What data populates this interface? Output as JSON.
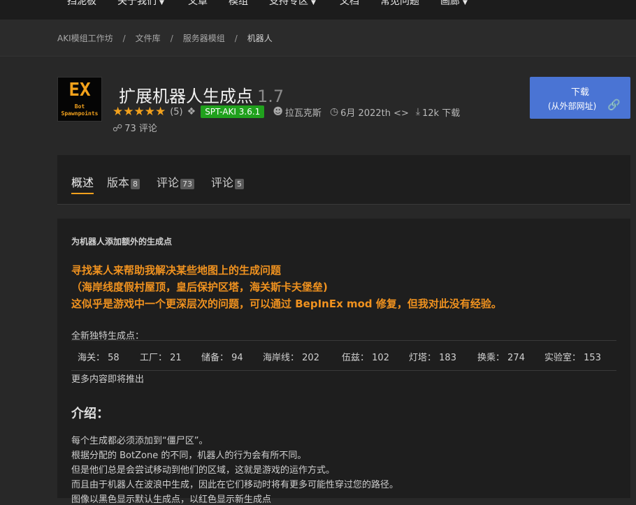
{
  "nav": {
    "items": [
      {
        "label": "挡泥板",
        "dropdown": false
      },
      {
        "label": "关于我们",
        "dropdown": true
      },
      {
        "label": "文章",
        "dropdown": false
      },
      {
        "label": "模组",
        "dropdown": false
      },
      {
        "label": "支持专区",
        "dropdown": true
      },
      {
        "label": "文档",
        "dropdown": false
      },
      {
        "label": "常见问题",
        "dropdown": false
      },
      {
        "label": "画廊",
        "dropdown": true
      }
    ]
  },
  "breadcrumb": [
    "AKI模组工作坊",
    "文件库",
    "服务器模组",
    "机器人"
  ],
  "mod": {
    "logo_text": "EX",
    "logo_sub_line1": "Bot",
    "logo_sub_line2": "Spawnpoints",
    "title": "扩展机器人生成点",
    "version": "1.7",
    "rating_count": "(5)",
    "stars": 5,
    "tag": "SPT-AKI 3.6.1",
    "author": "拉瓦克斯",
    "date": "6月 2022th <>",
    "downloads": "12k 下载",
    "reviews": "73 评论"
  },
  "download_button": {
    "line1": "下载",
    "line2": "(从外部网址)"
  },
  "tabs": [
    {
      "label": "概述",
      "count": null,
      "active": true
    },
    {
      "label": "版本",
      "count": "8",
      "active": false
    },
    {
      "label": "评论",
      "count": "73",
      "active": false
    },
    {
      "label": "评论",
      "count": "5",
      "active": false
    }
  ],
  "content": {
    "heading": "为机器人添加额外的生成点",
    "notice": [
      "寻找某人来帮助我解决某些地图上的生成问题",
      "（海岸线度假村屋顶，皇后保护区塔，海关斯卡夫堡垒)",
      "这似乎是游戏中一个更深层次的问题，可以通过 BepInEx mod 修复，但我对此没有经验。"
    ],
    "spawn_label": "全新独特生成点：",
    "spawns": [
      {
        "map": "海关：",
        "count": "58"
      },
      {
        "map": "工厂：",
        "count": "21"
      },
      {
        "map": "储备：",
        "count": "94"
      },
      {
        "map": "海岸线：",
        "count": "202"
      },
      {
        "map": "伍兹：",
        "count": "102"
      },
      {
        "map": "灯塔：",
        "count": "183"
      },
      {
        "map": "换乘：",
        "count": "274"
      },
      {
        "map": "实验室：",
        "count": "153"
      }
    ],
    "more": "更多内容即将推出",
    "intro_title": "介绍：",
    "intro_lines": [
      "每个生成都必须添加到“僵尸区”。",
      "根据分配的 BotZone 的不同，机器人的行为会有所不同。",
      "但是他们总是会尝试移动到他们的区域，这就是游戏的运作方式。",
      "而且由于机器人在波浪中生成，因此在它们移动时将有更多可能性穿过您的路径。",
      "图像以黑色显示默认生成点，以红色显示新生成点"
    ]
  },
  "colors": {
    "accent": "#f2a11d",
    "button": "#4a74d4",
    "badge": "#20a11d",
    "notice": "#f0921f"
  }
}
